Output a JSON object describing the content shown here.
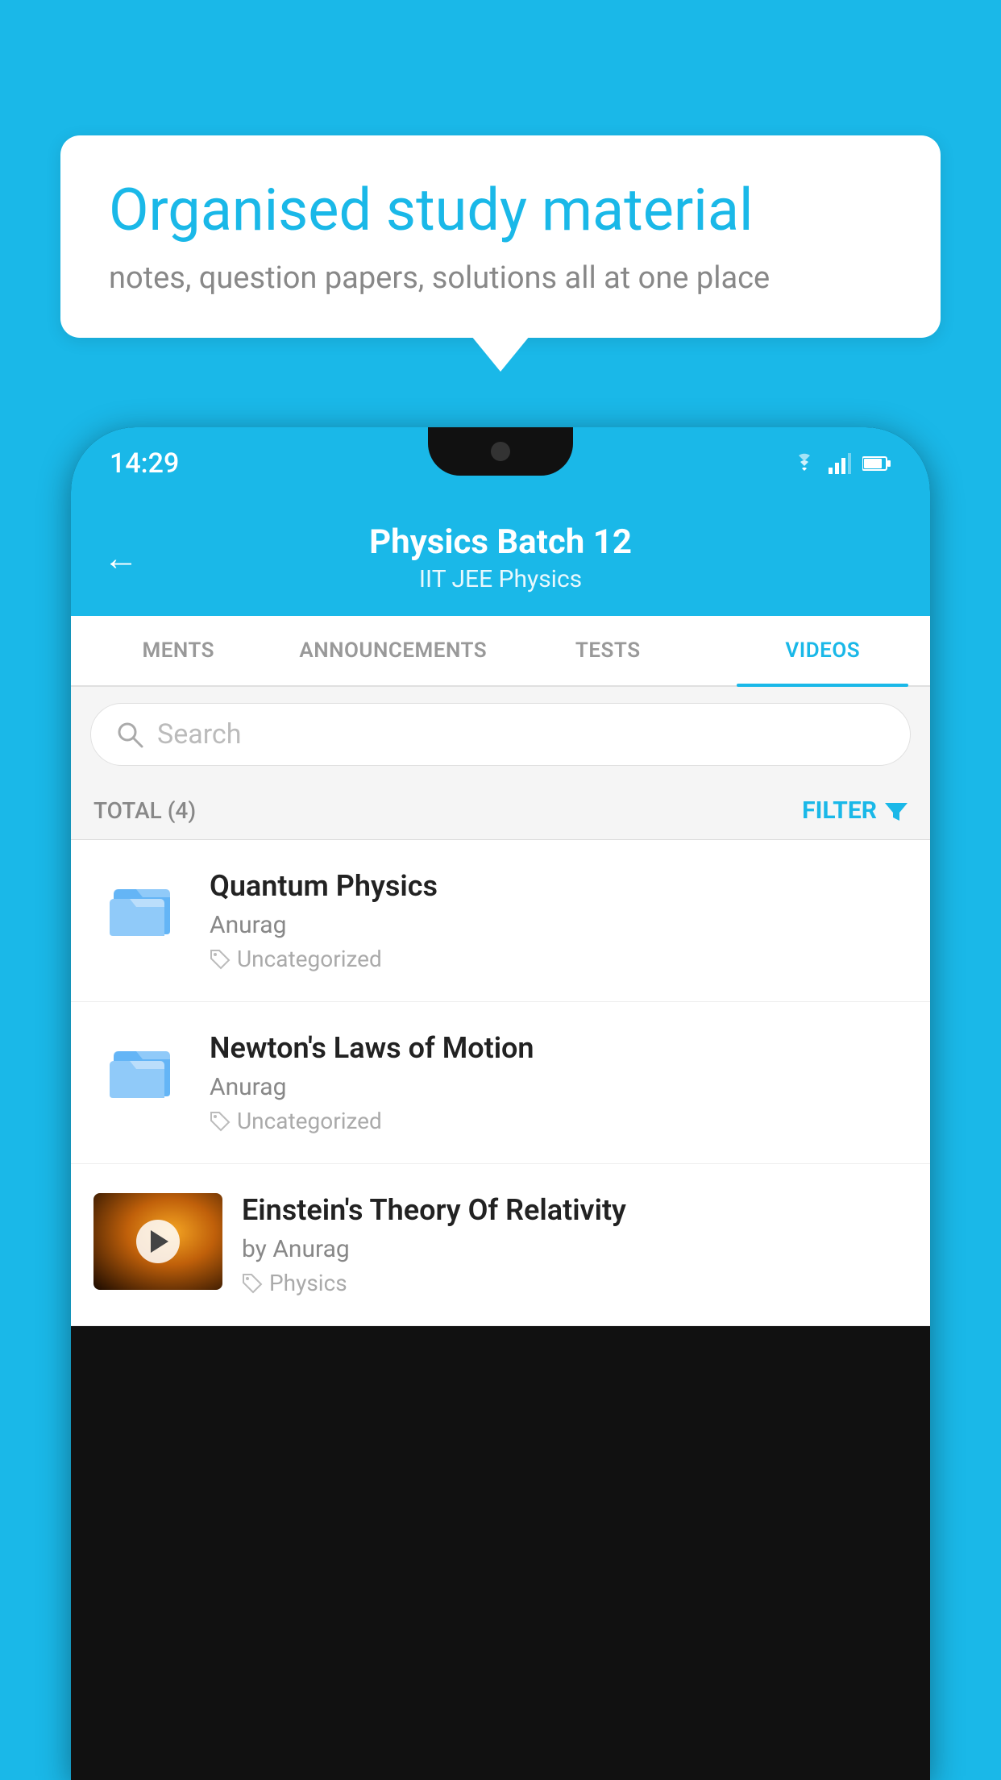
{
  "background": {
    "color": "#1ab8e8"
  },
  "speech_bubble": {
    "title": "Organised study material",
    "subtitle": "notes, question papers, solutions all at one place"
  },
  "phone": {
    "status_bar": {
      "time": "14:29",
      "icons": [
        "wifi",
        "signal",
        "battery"
      ]
    },
    "header": {
      "back_label": "←",
      "title": "Physics Batch 12",
      "subtitle_tags": "IIT JEE   Physics"
    },
    "tabs": [
      {
        "label": "MENTS",
        "active": false
      },
      {
        "label": "ANNOUNCEMENTS",
        "active": false
      },
      {
        "label": "TESTS",
        "active": false
      },
      {
        "label": "VIDEOS",
        "active": true
      }
    ],
    "search": {
      "placeholder": "Search"
    },
    "filter_bar": {
      "total_label": "TOTAL (4)",
      "filter_btn": "FILTER"
    },
    "videos": [
      {
        "id": 1,
        "title": "Quantum Physics",
        "author": "Anurag",
        "tag": "Uncategorized",
        "type": "folder",
        "has_thumbnail": false
      },
      {
        "id": 2,
        "title": "Newton's Laws of Motion",
        "author": "Anurag",
        "tag": "Uncategorized",
        "type": "folder",
        "has_thumbnail": false
      },
      {
        "id": 3,
        "title": "Einstein's Theory Of Relativity",
        "author": "by Anurag",
        "tag": "Physics",
        "type": "video",
        "has_thumbnail": true
      }
    ]
  }
}
